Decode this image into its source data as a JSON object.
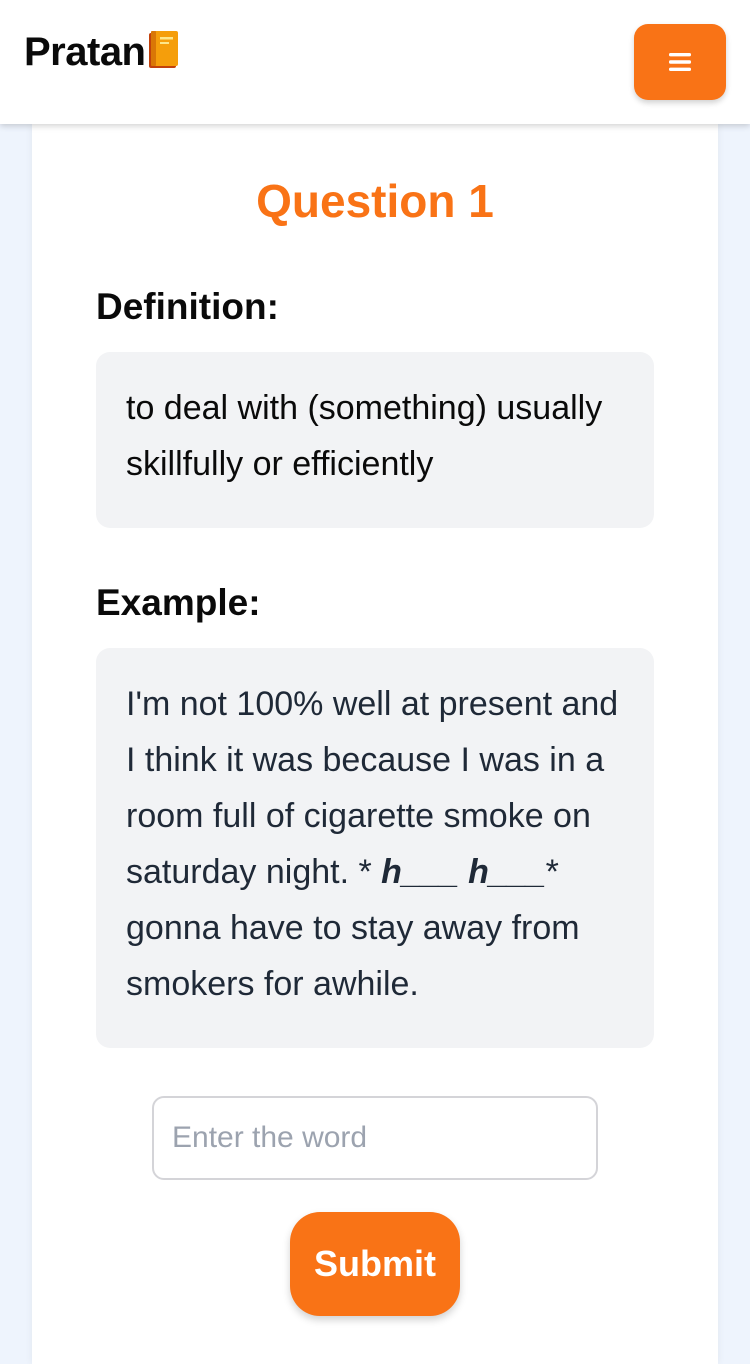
{
  "header": {
    "brand": "Pratan",
    "brand_icon": "book-icon",
    "menu_icon": "hamburger-menu-icon"
  },
  "quiz": {
    "title": "Question 1",
    "definition_heading": "Definition:",
    "definition_text": "to deal with (something) usually skillfully or efficiently",
    "example_heading": "Example:",
    "example_before": "I'm not 100% well at present and I think it was because I was in a room full of cigarette smoke on saturday night. *",
    "example_blank": "h___ h___",
    "example_after": "* gonna have to stay away from smokers for awhile.",
    "input_placeholder": "Enter the word",
    "input_value": "",
    "submit_label": "Submit"
  },
  "colors": {
    "accent": "#f97316",
    "page_background": "#eef4fd",
    "box_background": "#f2f3f5"
  }
}
